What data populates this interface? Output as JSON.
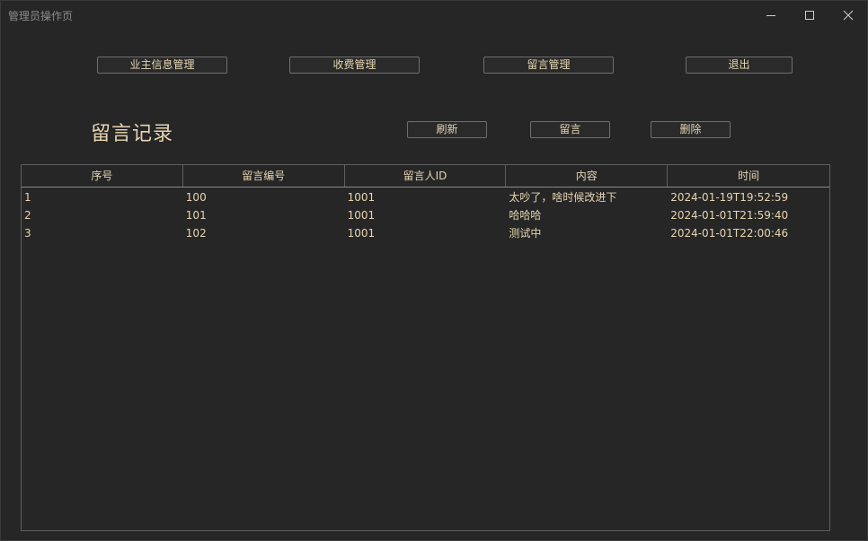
{
  "window": {
    "title": "管理员操作页"
  },
  "nav": {
    "owner_info_label": "业主信息管理",
    "fee_label": "收费管理",
    "message_label": "留言管理",
    "exit_label": "退出"
  },
  "section": {
    "title": "留言记录",
    "refresh_label": "刷新",
    "leave_message_label": "留言",
    "delete_label": "删除"
  },
  "table": {
    "headers": [
      "序号",
      "留言编号",
      "留言人ID",
      "内容",
      "时间"
    ],
    "rows": [
      [
        "1",
        "100",
        "1001",
        "太吵了，啥时候改进下",
        "2024-01-19T19:52:59"
      ],
      [
        "2",
        "101",
        "1001",
        "哈哈哈",
        "2024-01-01T21:59:40"
      ],
      [
        "3",
        "102",
        "1001",
        "测试中",
        "2024-01-01T22:00:46"
      ]
    ]
  },
  "colors": {
    "background": "#262626",
    "text": "#e6d5b0",
    "border": "#6e6e6e"
  },
  "icons": {
    "minimize": "minimize-icon",
    "maximize": "maximize-icon",
    "close": "close-icon"
  }
}
